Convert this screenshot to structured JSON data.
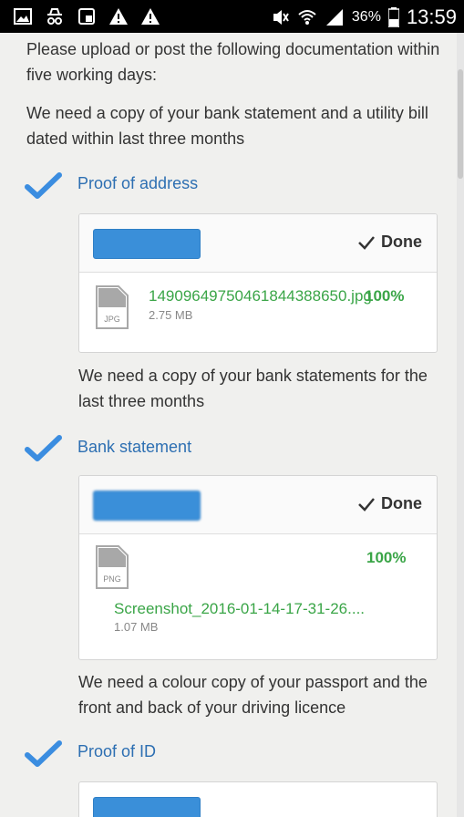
{
  "status_bar": {
    "battery_percent": "36%",
    "time": "13:59",
    "icons": [
      "gallery-icon",
      "incognito-icon",
      "screenshot-icon",
      "warning-icon",
      "warning-icon",
      "mute-icon",
      "wifi-icon",
      "signal-icon",
      "battery-icon"
    ]
  },
  "intro": {
    "line1": "Please upload or post the following documentation within five working days:"
  },
  "sections": [
    {
      "description": "We need a copy of your bank statement and a utility bill dated within last three months",
      "label": "Proof of address",
      "done_label": "Done",
      "file": {
        "type": "JPG",
        "name": "14909649750461844388650.jpg",
        "size": "2.75 MB",
        "percent": "100%"
      }
    },
    {
      "description": "We need a copy of your bank statements for the last three months",
      "label": "Bank statement",
      "done_label": "Done",
      "file": {
        "type": "PNG",
        "name": "Screenshot_2016-01-14-17-31-26....",
        "size": "1.07 MB",
        "percent": "100%"
      }
    },
    {
      "description": "We need a colour copy of your passport and the front and back of your driving licence",
      "label": "Proof of ID"
    }
  ],
  "colors": {
    "accent": "#2d6fb2",
    "check": "#3b8de0",
    "success": "#3aa547",
    "button": "#3a8fd9"
  }
}
